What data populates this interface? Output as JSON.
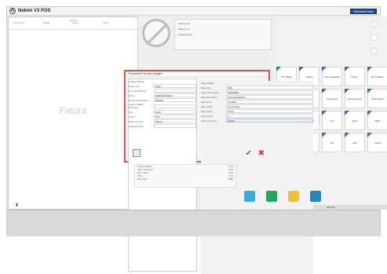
{
  "app": {
    "title": "Nebim V3 POS",
    "top_button": "Dönemsel Satış"
  },
  "left_panel": {
    "header_top": "Satırlar",
    "columns": [
      "Ürün\nKodu",
      "Miktar",
      "Birim",
      "Tutar"
    ],
    "watermark": "Fatura"
  },
  "center": {
    "info": {
      "items": [
        "Müşteri Adı",
        "Müşteri No",
        "Sadakat Kartı"
      ]
    },
    "camera_label": "Fotoğraf Yok"
  },
  "dialog": {
    "title": "Perakende Fiş İşlem Bilgileri",
    "left_section": "İrsaliye Bilgileri",
    "left_rows": [
      {
        "label": "Belge Tipi",
        "value": "Satış"
      },
      {
        "label": "Fiş Kod/ Bölümü",
        "value": ""
      },
      {
        "label": "Depo",
        "value": "MERKEZ DEPO"
      },
      {
        "label": "Personel Referans",
        "value": "000000"
      },
      {
        "label": "Ödeme Bilgisi Referans",
        "value": ""
      },
      {
        "label": "Kdv",
        "value": "Dahil"
      },
      {
        "label": "Döviz",
        "value": "TRL"
      },
      {
        "label": "Doküman Tipi",
        "value": "Fatura"
      },
      {
        "label": "Kapanış Tarihi",
        "value": ""
      }
    ],
    "right_section": "Satış Bilgileri",
    "right_rows": [
      {
        "label": "Belge No",
        "value": "PRS"
      },
      {
        "label": "Fatura Numarası",
        "value": "PRS00001"
      },
      {
        "label": "Satış Personeli",
        "value": "SATIŞ ELEMANI"
      },
      {
        "label": "Sipariş No",
        "value": "01.2019"
      },
      {
        "label": "Satış Tarihi",
        "value": "01.12.2019"
      },
      {
        "label": "Satış Saati",
        "value": "12:00"
      },
      {
        "label": "Fatura Seri",
        "value": "A"
      },
      {
        "label": "Fatura Sıra No",
        "value": "12345"
      }
    ],
    "ok": "✔",
    "cancel": "✖"
  },
  "summary": {
    "rows": [
      {
        "label": "Toplam Miktar",
        "value": "0,00"
      },
      {
        "label": "Satır İndirimleri",
        "value": "0,00"
      },
      {
        "label": "Dip İndirim",
        "value": "0,00"
      },
      {
        "label": "KDV",
        "value": "0,00"
      },
      {
        "label": "Net Tutar",
        "value": "0,00"
      }
    ]
  },
  "right_panel": {
    "tile_labels": [
      "Ürün Bilgisi",
      "Müşteri",
      "Ürün Açıklaması",
      "Ödeme",
      "Ek Özellikler",
      "Satış",
      "Fiyat",
      "Kampanya",
      "Fatura Ayarları",
      "Toplu İşlemler",
      "Peşin",
      "Kredi Kartı",
      "Çek",
      "Senet",
      "Diğer",
      "Fiş Yazdır",
      "Kopya",
      "Yeni",
      "İptal",
      "Kapat"
    ],
    "category_label": "Menüler"
  },
  "colors": {
    "dialog_border": "#d55b5b",
    "brand_blue": "#1d4f9c"
  }
}
